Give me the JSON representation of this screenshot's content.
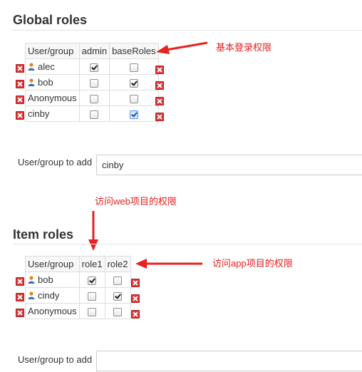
{
  "global_roles": {
    "title": "Global roles",
    "columns": [
      "User/group",
      "admin",
      "baseRoles"
    ],
    "rows": [
      {
        "name": "alec",
        "type": "user",
        "values": [
          true,
          false
        ]
      },
      {
        "name": "bob",
        "type": "user",
        "values": [
          false,
          true
        ]
      },
      {
        "name": "Anonymous",
        "type": "group",
        "values": [
          false,
          false
        ]
      },
      {
        "name": "cinby",
        "type": "plain",
        "values": [
          false,
          true
        ]
      }
    ],
    "add_label": "User/group to add",
    "add_value": "cinby",
    "annotation": "基本登录权限"
  },
  "web_annotation": "访问web项目的权限",
  "item_roles": {
    "title": "Item roles",
    "columns": [
      "User/group",
      "role1",
      "role2"
    ],
    "rows": [
      {
        "name": "bob",
        "type": "user",
        "values": [
          true,
          false
        ]
      },
      {
        "name": "cindy",
        "type": "user",
        "values": [
          false,
          true
        ]
      },
      {
        "name": "Anonymous",
        "type": "group",
        "values": [
          false,
          false
        ]
      }
    ],
    "add_label": "User/group to add",
    "add_value": "",
    "annotation": "访问app项目的权限"
  },
  "colors": {
    "annotation": "#e82020",
    "delete": "#d83a3a",
    "icon": "#d98a1a"
  }
}
